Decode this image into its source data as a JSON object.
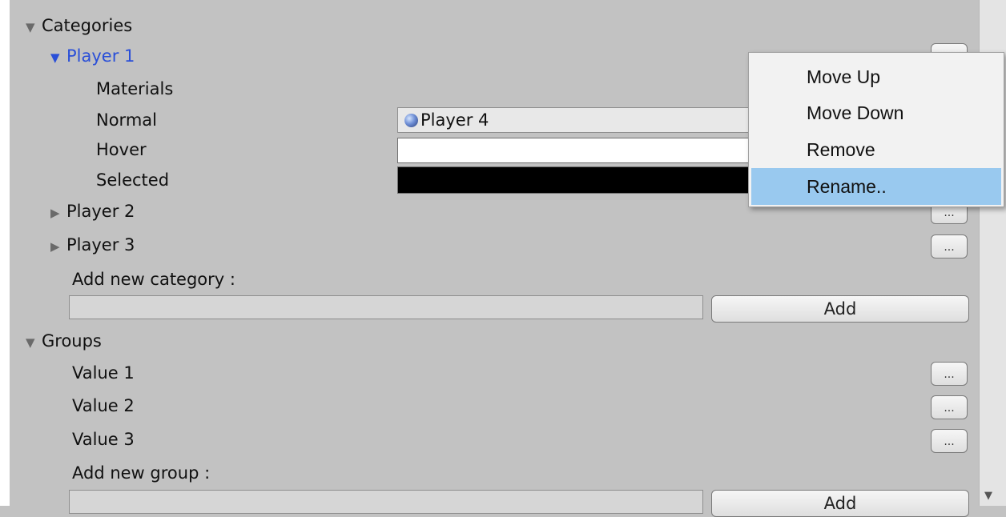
{
  "categories": {
    "title": "Categories",
    "player1": {
      "label": "Player 1",
      "materials_label": "Materials",
      "normal_label": "Normal",
      "normal_value": "Player 4",
      "hover_label": "Hover",
      "hover_color": "#ffffff",
      "selected_label": "Selected",
      "selected_color": "#000000"
    },
    "player2": {
      "label": "Player 2"
    },
    "player3": {
      "label": "Player 3"
    },
    "add_label": "Add new category :",
    "add_input_value": "",
    "add_button": "Add"
  },
  "groups": {
    "title": "Groups",
    "items": [
      "Value 1",
      "Value 2",
      "Value 3"
    ],
    "add_label": "Add new group :",
    "add_input_value": "",
    "add_button": "Add"
  },
  "options_button_label": "...",
  "context_menu": {
    "items": [
      "Move Up",
      "Move Down",
      "Remove",
      "Rename.."
    ],
    "highlighted": "Rename.."
  },
  "icons": {
    "expanded": "triangle-down-icon",
    "collapsed": "triangle-right-icon",
    "material": "sphere-icon",
    "scroll_down": "scroll-down-arrow-icon"
  },
  "colors": {
    "background": "#c2c2c2",
    "selected_text": "#2a4fd8",
    "menu_highlight": "#99c9ef"
  }
}
